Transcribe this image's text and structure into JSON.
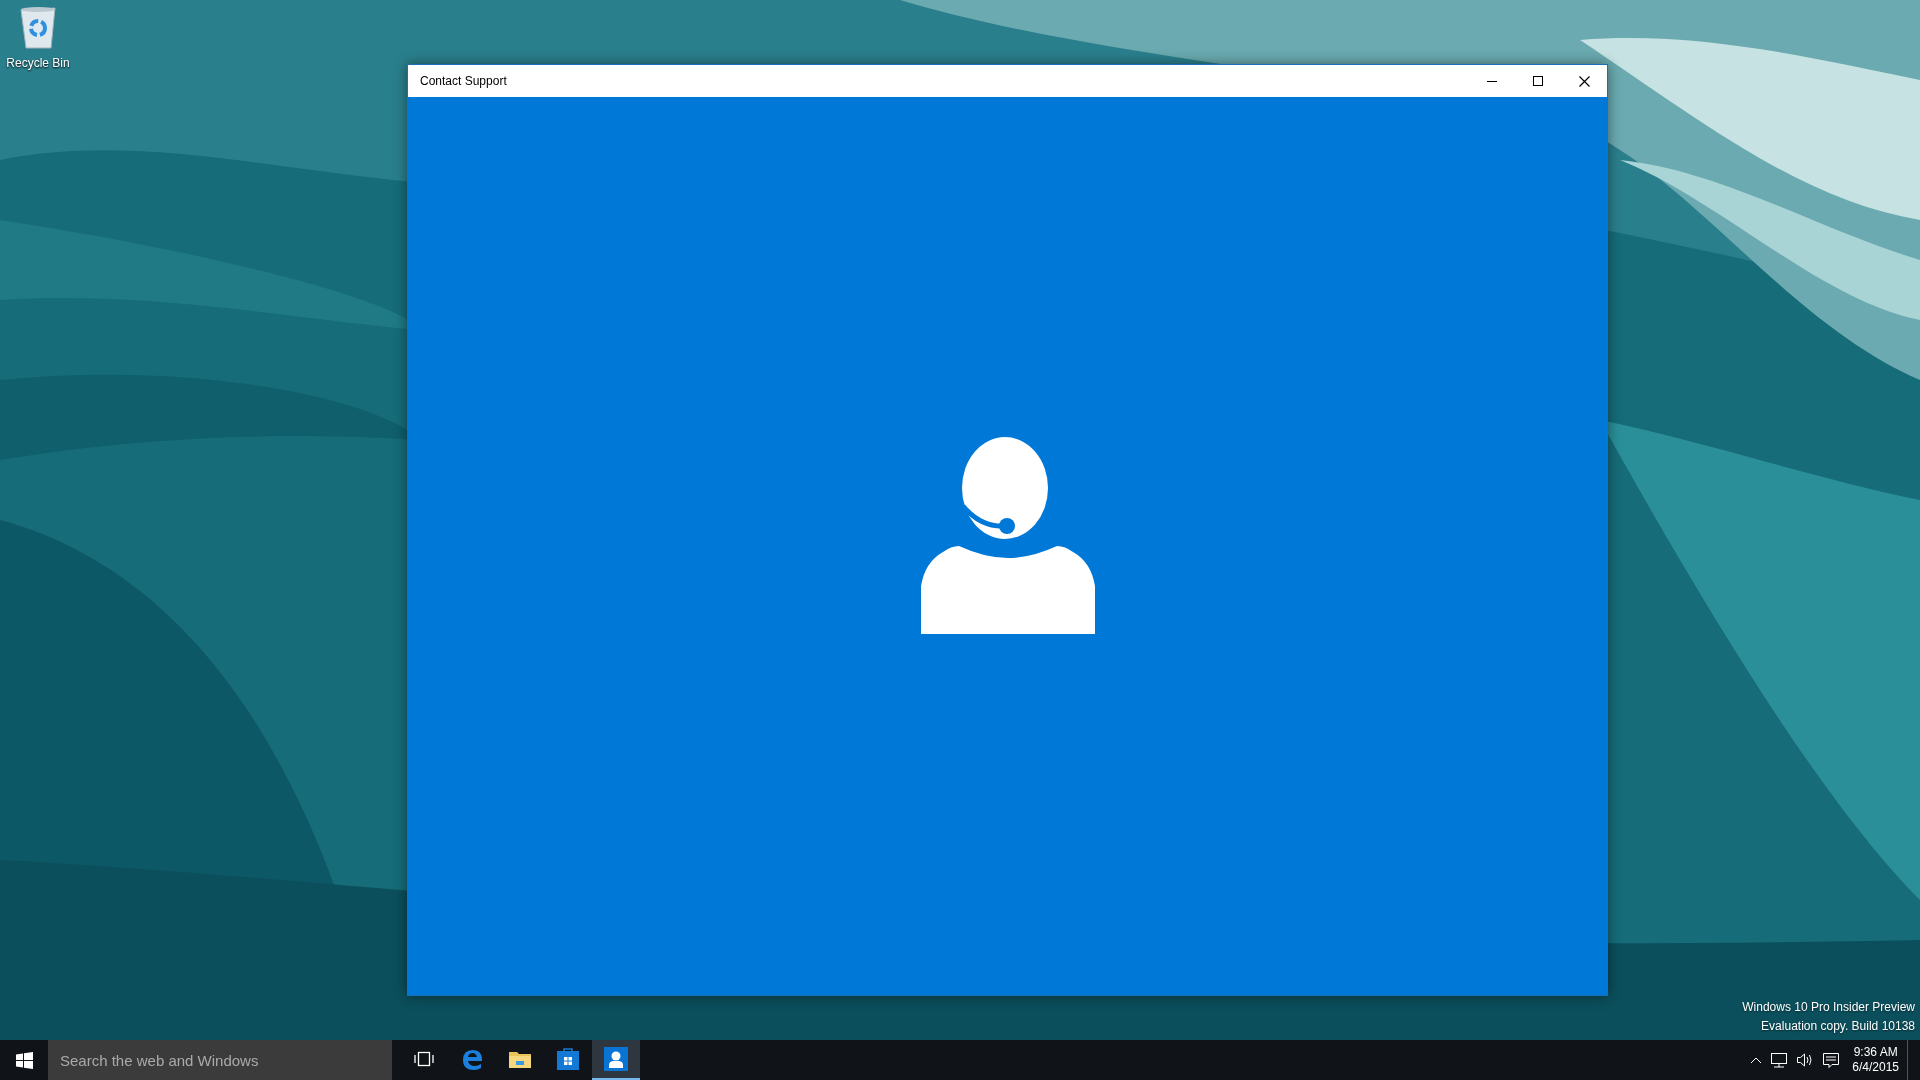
{
  "desktop": {
    "icons": [
      {
        "kind": "recycle-bin",
        "label": "Recycle Bin"
      }
    ]
  },
  "window": {
    "title": "Contact Support"
  },
  "taskbar": {
    "search": {
      "placeholder": "Search the web and Windows"
    },
    "apps": [
      {
        "kind": "task-view",
        "selected": false
      },
      {
        "kind": "edge",
        "selected": false
      },
      {
        "kind": "folder",
        "selected": false
      },
      {
        "kind": "store",
        "selected": false
      },
      {
        "kind": "support",
        "selected": true
      }
    ],
    "tray": {
      "time": "9:36 AM",
      "date": "6/4/2015"
    }
  },
  "build_info": [
    "Windows 10 Pro Insider Preview",
    "Evaluation copy. Build 10138"
  ]
}
